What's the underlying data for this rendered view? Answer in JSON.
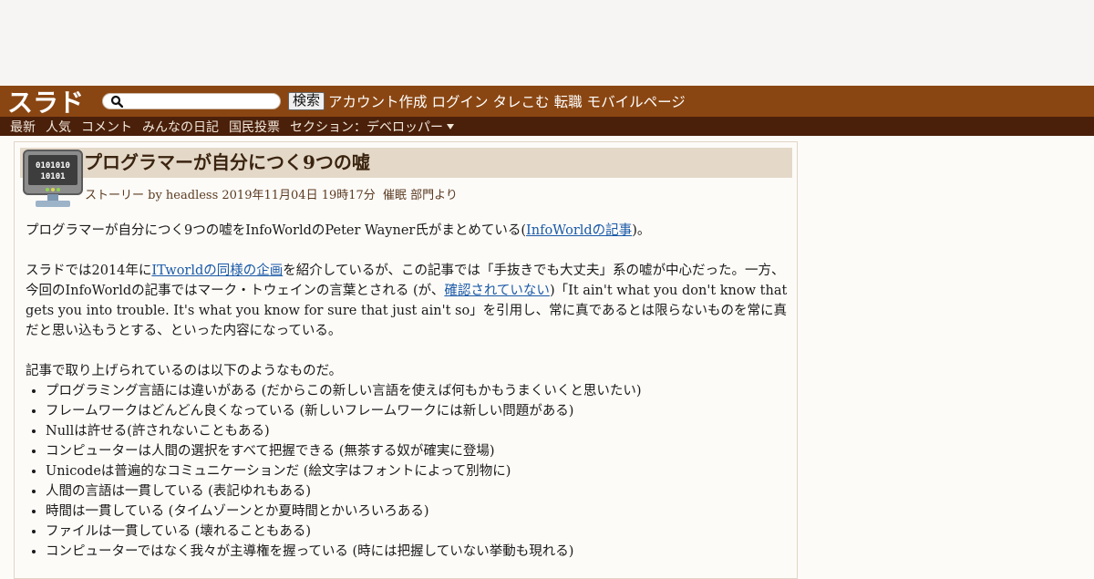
{
  "header": {
    "logo": "スラド",
    "search_placeholder": "",
    "search_button": "検索",
    "links": [
      "アカウント作成",
      "ログイン",
      "タレこむ",
      "転職",
      "モバイルページ"
    ]
  },
  "subnav": {
    "items": [
      "最新",
      "人気",
      "コメント",
      "みんなの日記",
      "国民投票"
    ],
    "section": "セクション：デベロッパー"
  },
  "article": {
    "title": "プログラマーが自分につく9つの嘘",
    "icon_text": [
      "0101010",
      "10101"
    ],
    "meta": "ストーリー by headless 2019年11月04日 19時17分",
    "meta_dept": "催眠 部門より",
    "p1_text": "プログラマーが自分につく9つの嘘をInfoWorldのPeter Wayner氏がまとめている(",
    "p1_link": "InfoWorldの記事",
    "p1_end": ")。",
    "p2_a": "スラドでは2014年に",
    "p2_link1": "ITworldの同様の企画",
    "p2_b": "を紹介しているが、この記事では「手抜きでも大丈夫」系の嘘が中心だった。一方、今回のInfoWorldの記事ではマーク・トウェインの言葉とされる (が、",
    "p2_link2": "確認されていない",
    "p2_c": ")「It ain't what you don't know that gets you into trouble. It's what you know for sure that just ain't so」を引用し、常に真であるとは限らないものを常に真だと思い込もうとする、といった内容になっている。",
    "p3": "記事で取り上げられているのは以下のようなものだ。",
    "list": [
      "プログラミング言語には違いがある (だからこの新しい言語を使えば何もかもうまくいくと思いたい)",
      "フレームワークはどんどん良くなっている (新しいフレームワークには新しい問題がある)",
      "Nullは許せる(許されないこともある)",
      "コンピューターは人間の選択をすべて把握できる (無茶する奴が確実に登場)",
      "Unicodeは普遍的なコミュニケーションだ (絵文字はフォントによって別物に)",
      "人間の言語は一貫している (表記ゆれもある)",
      "時間は一貫している (タイムゾーンとか夏時間とかいろいろある)",
      "ファイルは一貫している (壊れることもある)",
      "コンピューターではなく我々が主導権を握っている (時には把握していない挙動も現れる)"
    ]
  }
}
